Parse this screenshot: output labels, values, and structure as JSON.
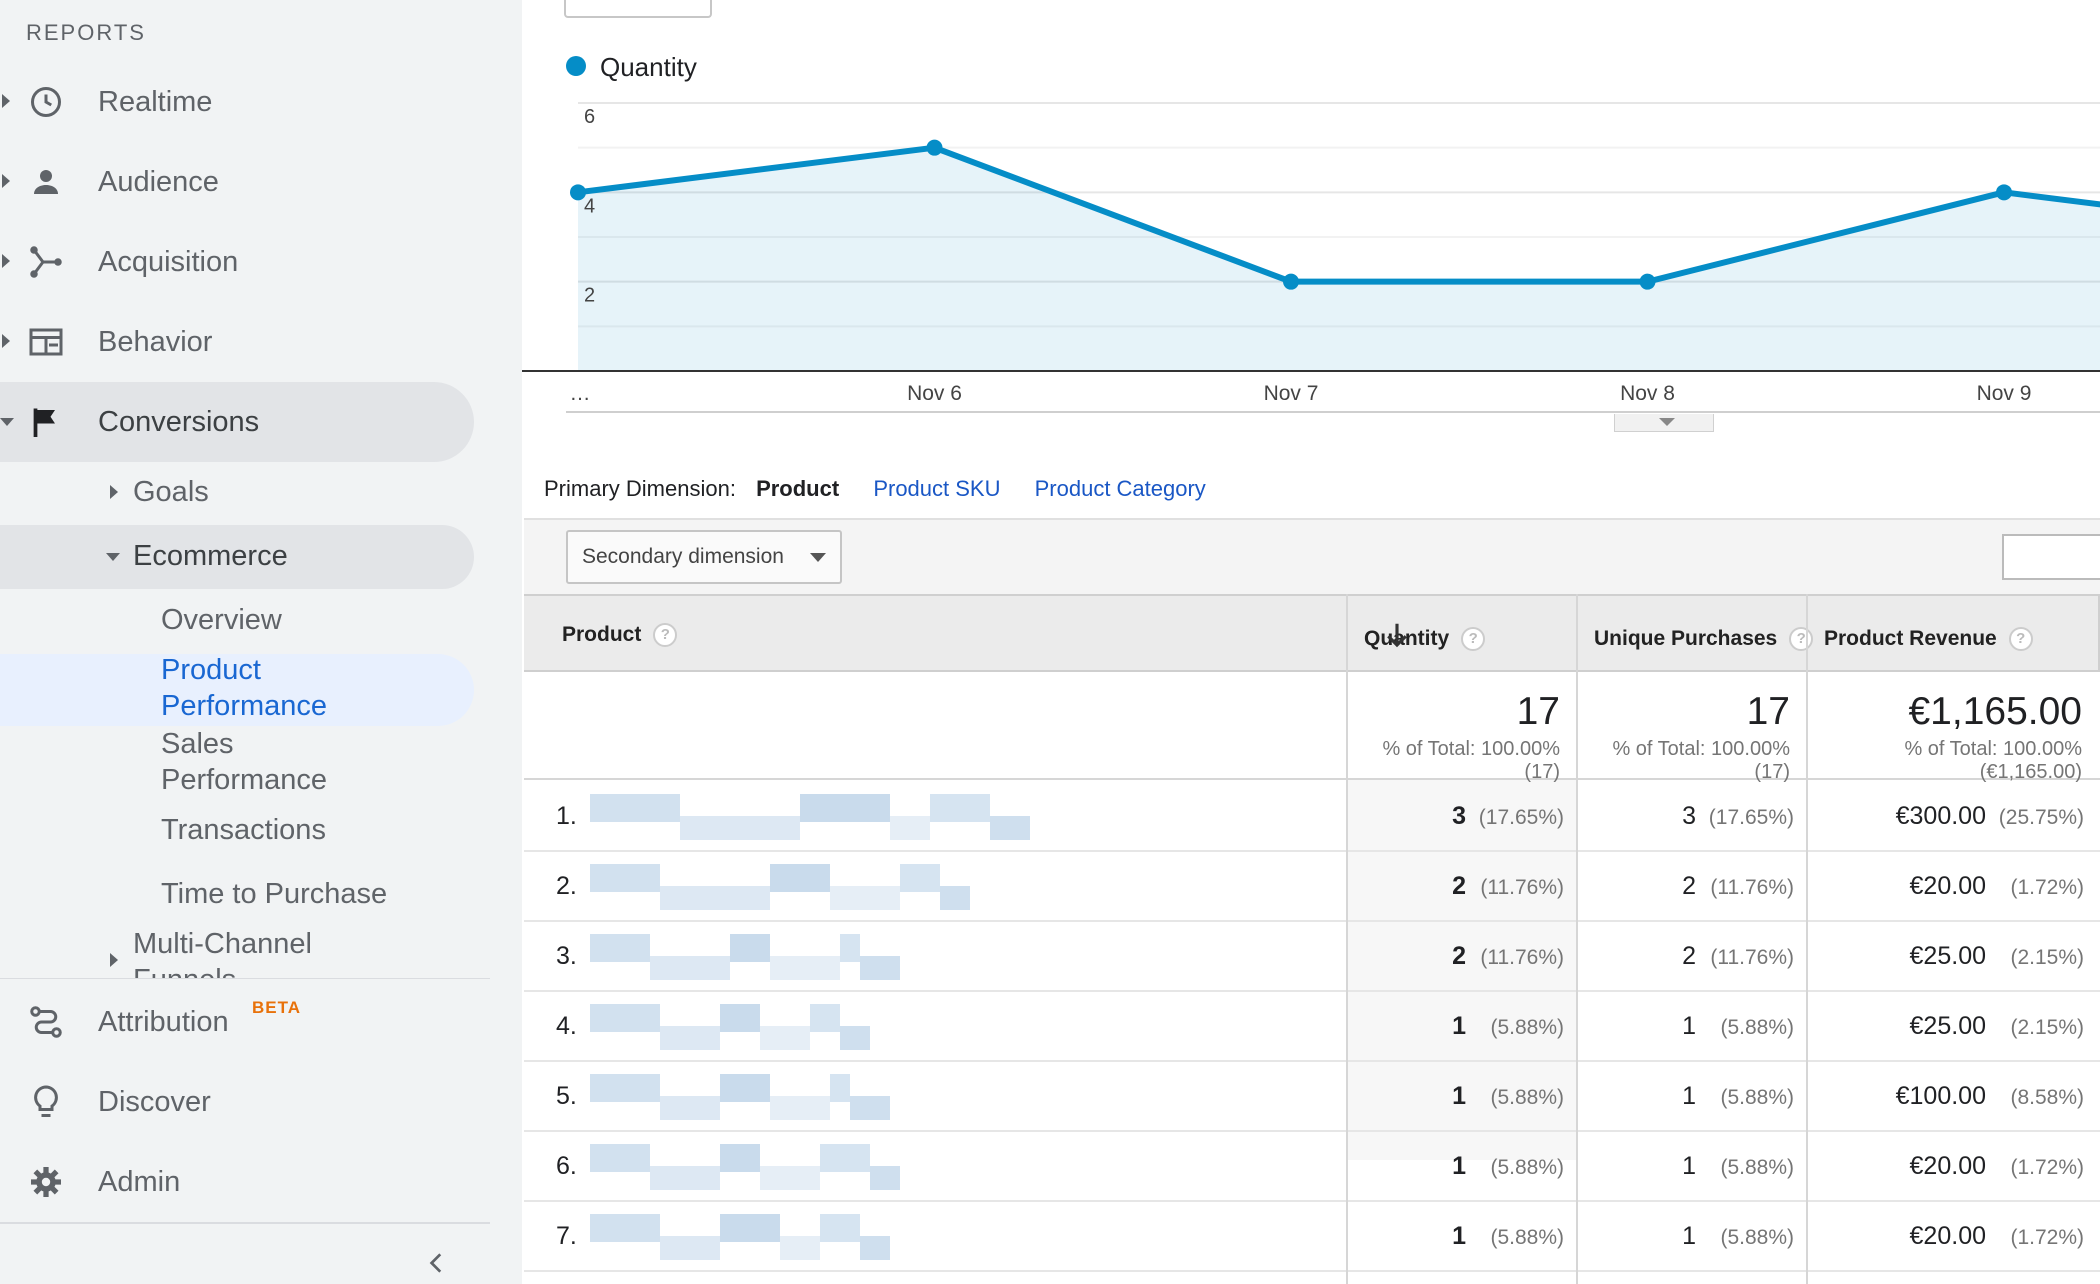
{
  "sidebar": {
    "heading": "REPORTS",
    "top_items": [
      {
        "label": "Realtime",
        "icon": "clock-icon"
      },
      {
        "label": "Audience",
        "icon": "person-icon"
      },
      {
        "label": "Acquisition",
        "icon": "acquisition-icon"
      },
      {
        "label": "Behavior",
        "icon": "behavior-icon"
      },
      {
        "label": "Conversions",
        "icon": "flag-icon"
      }
    ],
    "goals": "Goals",
    "ecommerce": "Ecommerce",
    "ecommerce_items": {
      "overview": "Overview",
      "product_performance_1": "Product",
      "product_performance_2": "Performance",
      "sales_performance_1": "Sales",
      "sales_performance_2": "Performance",
      "transactions": "Transactions",
      "time_to_purchase": "Time to Purchase"
    },
    "multi_channel": "Multi-Channel",
    "funnels": "Funnels",
    "bottom_items": [
      {
        "label": "Attribution",
        "icon": "attribution-icon"
      },
      {
        "label": "Discover",
        "icon": "lightbulb-icon"
      },
      {
        "label": "Admin",
        "icon": "gear-icon"
      }
    ],
    "beta_badge": "BETA"
  },
  "chart_data": {
    "type": "area",
    "series": [
      {
        "name": "Quantity",
        "color": "#058dc7",
        "values": [
          4,
          5,
          2,
          2,
          4,
          3
        ]
      }
    ],
    "x": [
      "…",
      "Nov 6",
      "Nov 7",
      "Nov 8",
      "Nov 9",
      ""
    ],
    "y_ticks": [
      "6",
      "4",
      "2"
    ],
    "ylim": [
      0,
      6
    ],
    "grid": true
  },
  "primary_dimension": {
    "label": "Primary Dimension:",
    "active": "Product",
    "links": [
      "Product SKU",
      "Product Category"
    ]
  },
  "toolbar": {
    "secondary_dimension": "Secondary dimension"
  },
  "table": {
    "headers": {
      "product": "Product",
      "quantity": "Quantity",
      "unique_purchases": "Unique Purchases",
      "product_revenue": "Product Revenue",
      "help": "?"
    },
    "totals": {
      "quantity": "17",
      "quantity_sub": "% of Total: 100.00% (17)",
      "unique": "17",
      "unique_sub": "% of Total: 100.00% (17)",
      "revenue": "€1,165.00",
      "revenue_sub": "% of Total: 100.00% (€1,165.00)"
    },
    "rows": [
      {
        "num": "1.",
        "qty": "3",
        "qty_pct": "(17.65%)",
        "uniq": "3",
        "uniq_pct": "(17.65%)",
        "rev": "€300.00",
        "rev_pct": "(25.75%)"
      },
      {
        "num": "2.",
        "qty": "2",
        "qty_pct": "(11.76%)",
        "uniq": "2",
        "uniq_pct": "(11.76%)",
        "rev": "€20.00",
        "rev_pct": "(1.72%)"
      },
      {
        "num": "3.",
        "qty": "2",
        "qty_pct": "(11.76%)",
        "uniq": "2",
        "uniq_pct": "(11.76%)",
        "rev": "€25.00",
        "rev_pct": "(2.15%)"
      },
      {
        "num": "4.",
        "qty": "1",
        "qty_pct": "(5.88%)",
        "uniq": "1",
        "uniq_pct": "(5.88%)",
        "rev": "€25.00",
        "rev_pct": "(2.15%)"
      },
      {
        "num": "5.",
        "qty": "1",
        "qty_pct": "(5.88%)",
        "uniq": "1",
        "uniq_pct": "(5.88%)",
        "rev": "€100.00",
        "rev_pct": "(8.58%)"
      },
      {
        "num": "6.",
        "qty": "1",
        "qty_pct": "(5.88%)",
        "uniq": "1",
        "uniq_pct": "(5.88%)",
        "rev": "€20.00",
        "rev_pct": "(1.72%)"
      },
      {
        "num": "7.",
        "qty": "1",
        "qty_pct": "(5.88%)",
        "uniq": "1",
        "uniq_pct": "(5.88%)",
        "rev": "€20.00",
        "rev_pct": "(1.72%)"
      }
    ]
  }
}
